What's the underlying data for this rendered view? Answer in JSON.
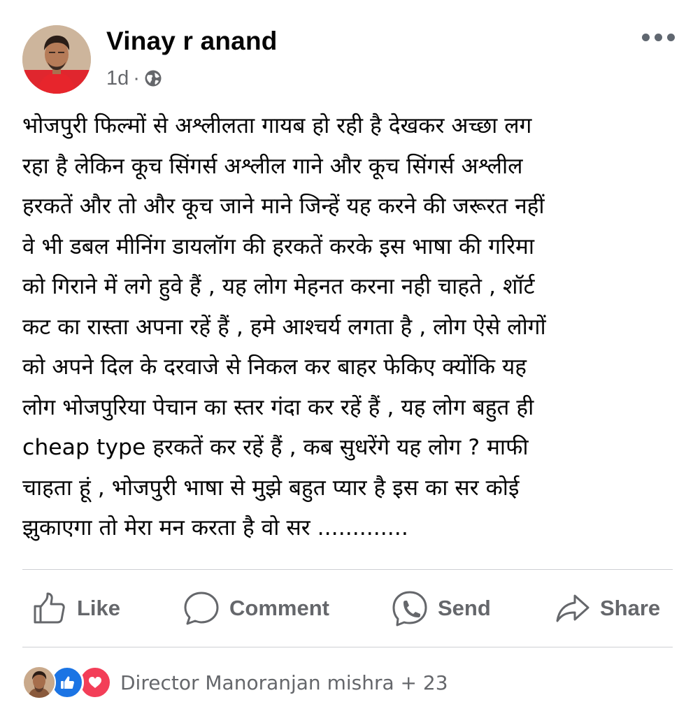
{
  "post": {
    "author_name": "Vinay r anand",
    "time": "1d",
    "separator": "·",
    "privacy_icon": "globe-icon",
    "more_icon": "more-dots-icon",
    "text": "भोजपुरी फिल्मों से अश्लीलता गायब हो रही है देखकर अच्छा लग\nरहा है लेकिन कूच सिंगर्स अश्लील गाने और कूच सिंगर्स अश्लील\nहरकतें और तो और कूच जाने माने जिन्हें यह करने की जरूरत नहीं\nवे  भी डबल मीनिंग डायलॉग की हरकतें करके इस भाषा की गरिमा\nको गिराने में लगे हुवे हैं , यह लोग मेहनत करना नही चाहते , शॉर्ट\nकट का रास्ता अपना रहें हैं , हमे आश्चर्य लगता है ,  लोग ऐसे लोगों\nको अपने दिल के दरवाजे से निकल कर बाहर फेकिए  क्योंकि यह\nलोग भोजपुरिया पेचान का स्तर गंदा कर रहें हैं , यह लोग बहुत ही\ncheap type हरकतें कर रहें हैं  , कब सुधरेंगे यह लोग ? माफी\nचाहता हूं , भोजपुरी भाषा से मुझे बहुत प्यार है इस का सर कोई\nझुकाएगा  तो मेरा मन करता है वो सर ............."
  },
  "actions": {
    "like": {
      "label": "Like",
      "icon": "thumbs-up-icon"
    },
    "comment": {
      "label": "Comment",
      "icon": "comment-bubble-icon"
    },
    "send": {
      "label": "Send",
      "icon": "messenger-send-icon"
    },
    "share": {
      "label": "Share",
      "icon": "share-arrow-icon"
    }
  },
  "reactions": {
    "icons": [
      "like-reaction-icon",
      "love-reaction-icon"
    ],
    "summary": "Director Manoranjan mishra + 23"
  },
  "colors": {
    "text": "#050505",
    "secondary": "#65676b",
    "divider": "#ced0d4",
    "like_blue": "#1b74e4",
    "love_red": "#f33e58"
  }
}
